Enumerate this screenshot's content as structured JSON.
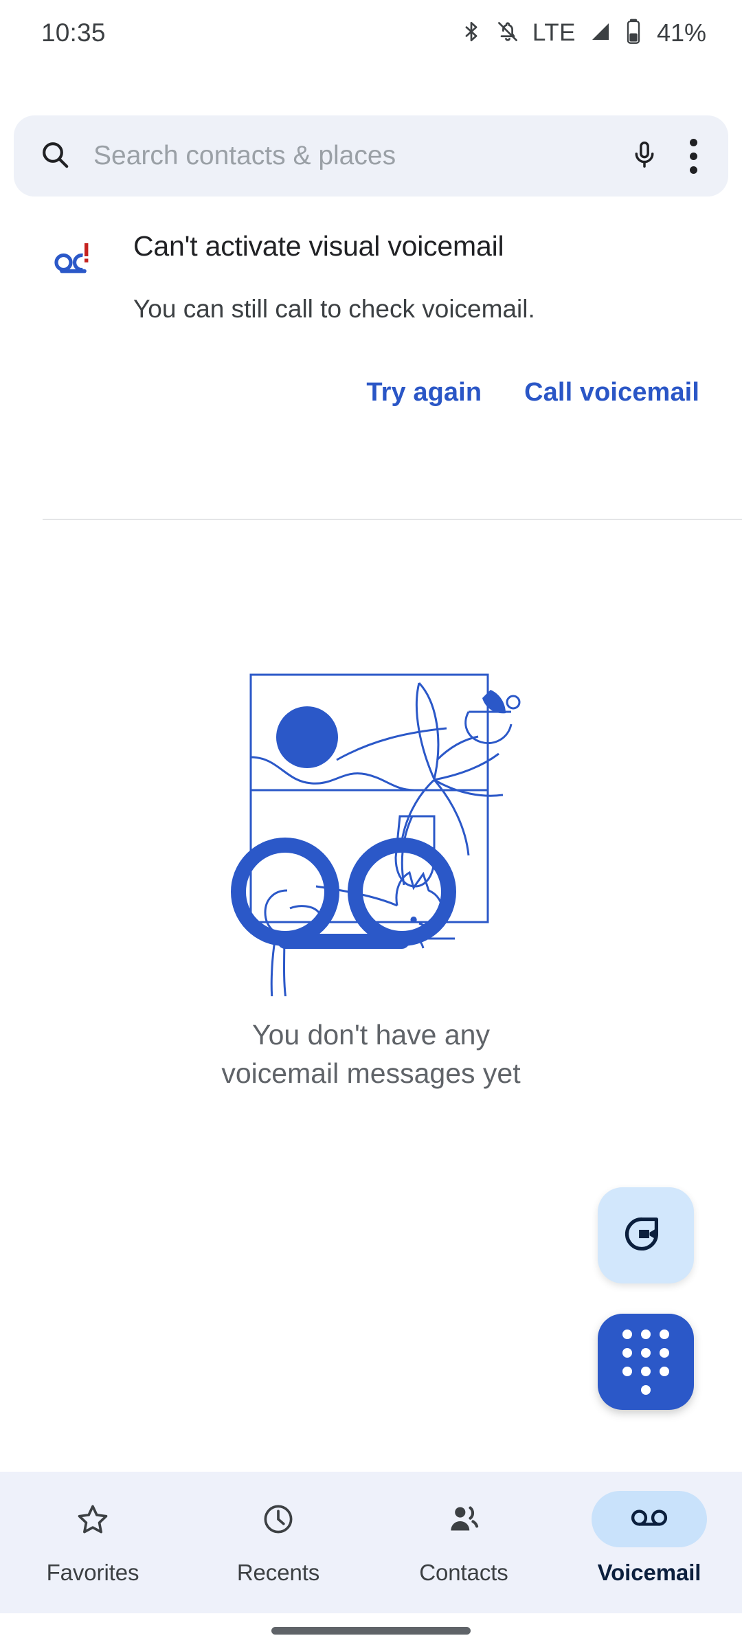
{
  "status_bar": {
    "time": "10:35",
    "network_type": "LTE",
    "battery_percent": "41%",
    "icons": [
      "bluetooth-icon",
      "notifications-off-icon",
      "signal-icon",
      "battery-icon"
    ]
  },
  "search": {
    "placeholder": "Search contacts & places",
    "search_icon": "search-icon",
    "mic_icon": "microphone-icon",
    "overflow_icon": "more-options-icon"
  },
  "vvm_error": {
    "icon": "voicemail-error-icon",
    "title": "Can't activate visual voicemail",
    "body": "You can still call to check voicemail.",
    "actions": [
      {
        "label": "Try again",
        "name": "try-again-button"
      },
      {
        "label": "Call voicemail",
        "name": "call-voicemail-button"
      }
    ]
  },
  "empty_state": {
    "illustration": "cat-window-voicemail-illustration",
    "line1": "You don't have any",
    "line2": "voicemail messages yet"
  },
  "fabs": [
    {
      "name": "video-call-fab",
      "icon": "video-call-icon"
    },
    {
      "name": "dialpad-fab",
      "icon": "dialpad-icon"
    }
  ],
  "bottom_nav": {
    "items": [
      {
        "label": "Favorites",
        "icon": "star-icon",
        "active": false
      },
      {
        "label": "Recents",
        "icon": "clock-icon",
        "active": false
      },
      {
        "label": "Contacts",
        "icon": "people-icon",
        "active": false
      },
      {
        "label": "Voicemail",
        "icon": "voicemail-icon",
        "active": true
      }
    ]
  },
  "colors": {
    "accent_blue": "#2a56c6",
    "illustration_blue": "#2b58c8",
    "fab_light_blue": "#d2e7fc",
    "nav_background": "#eef1fa",
    "nav_active_pill": "#c9e2fb",
    "search_background": "#eef1f8",
    "text_primary": "#202124",
    "text_secondary": "#5f6368",
    "error_accent_red": "#c5221f"
  }
}
